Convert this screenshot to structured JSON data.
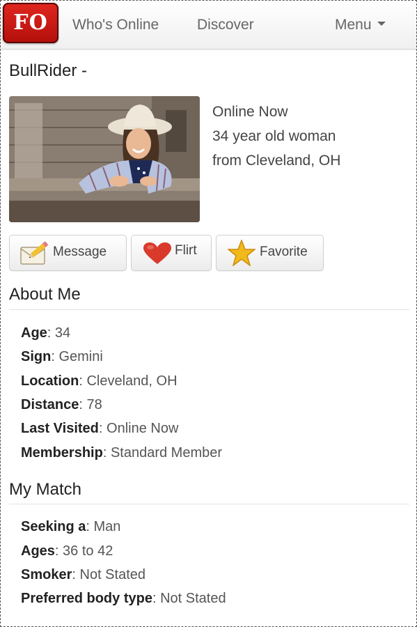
{
  "navbar": {
    "logo_text": "FO",
    "links": [
      "Who's Online",
      "Discover"
    ],
    "menu_label": "Menu"
  },
  "profile": {
    "username": "BullRider -",
    "status": "Online Now",
    "description": "34 year old woman",
    "location_line": "from Cleveland, OH"
  },
  "actions": {
    "message": "Message",
    "flirt": "Flirt",
    "favorite": "Favorite"
  },
  "about": {
    "title": "About Me",
    "fields": [
      {
        "label": "Age",
        "value": "34"
      },
      {
        "label": "Sign",
        "value": "Gemini"
      },
      {
        "label": "Location",
        "value": "Cleveland, OH"
      },
      {
        "label": "Distance",
        "value": "78"
      },
      {
        "label": "Last Visited",
        "value": "Online Now"
      },
      {
        "label": "Membership",
        "value": "Standard Member"
      }
    ]
  },
  "match": {
    "title": "My Match",
    "fields": [
      {
        "label": "Seeking a",
        "value": "Man"
      },
      {
        "label": "Ages",
        "value": "36 to 42"
      },
      {
        "label": "Smoker",
        "value": "Not Stated"
      },
      {
        "label": "Preferred body type",
        "value": "Not Stated"
      }
    ]
  },
  "colors": {
    "logo_red": "#c8171a",
    "nav_text": "#666666",
    "heart": "#d93a2b",
    "star": "#f2b91d"
  }
}
